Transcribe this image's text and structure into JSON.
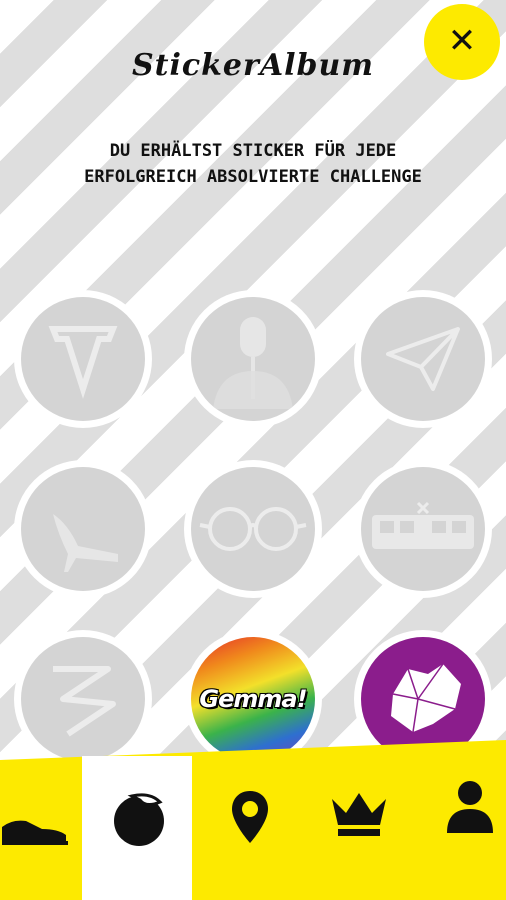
{
  "header": {
    "title": "StickerAlbum",
    "close_label": "✕"
  },
  "intro": {
    "text": "Du erhältst Sticker für jede erfolgreich absolvierte Challenge"
  },
  "stickers": [
    {
      "name": "v-logo",
      "unlocked": false
    },
    {
      "name": "microphone",
      "unlocked": false
    },
    {
      "name": "paper-plane",
      "unlocked": false
    },
    {
      "name": "high-heel",
      "unlocked": false
    },
    {
      "name": "round-glasses",
      "unlocked": false
    },
    {
      "name": "tram",
      "unlocked": false
    },
    {
      "name": "graffiti-swirl",
      "unlocked": false
    },
    {
      "name": "gemma-rainbow",
      "unlocked": true,
      "label": "Gemma!"
    },
    {
      "name": "vienna-map",
      "unlocked": true
    }
  ],
  "colors": {
    "accent": "#fdea00",
    "locked": "#d4d4d4",
    "locked_icon": "#ececec",
    "vienna_purple": "#8b1d8c"
  },
  "nav": {
    "items": [
      "shoe-icon",
      "sticker-icon",
      "location-pin-icon",
      "crown-icon",
      "user-icon"
    ],
    "active": "sticker-icon"
  }
}
